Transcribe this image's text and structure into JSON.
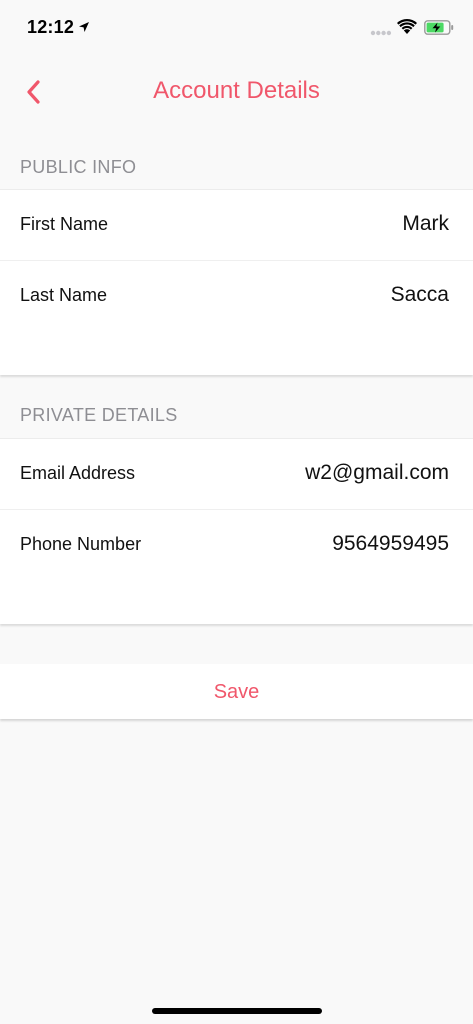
{
  "status_bar": {
    "time": "12:12"
  },
  "nav": {
    "title": "Account Details",
    "accent_color": "#f0576b"
  },
  "public_info": {
    "header": "PUBLIC INFO",
    "first_name_label": "First Name",
    "first_name_value": "Mark",
    "last_name_label": "Last Name",
    "last_name_value": "Sacca"
  },
  "private_details": {
    "header": "PRIVATE DETAILS",
    "email_label": "Email Address",
    "email_value": "w2@gmail.com",
    "phone_label": "Phone Number",
    "phone_value": "9564959495"
  },
  "actions": {
    "save_label": "Save"
  }
}
